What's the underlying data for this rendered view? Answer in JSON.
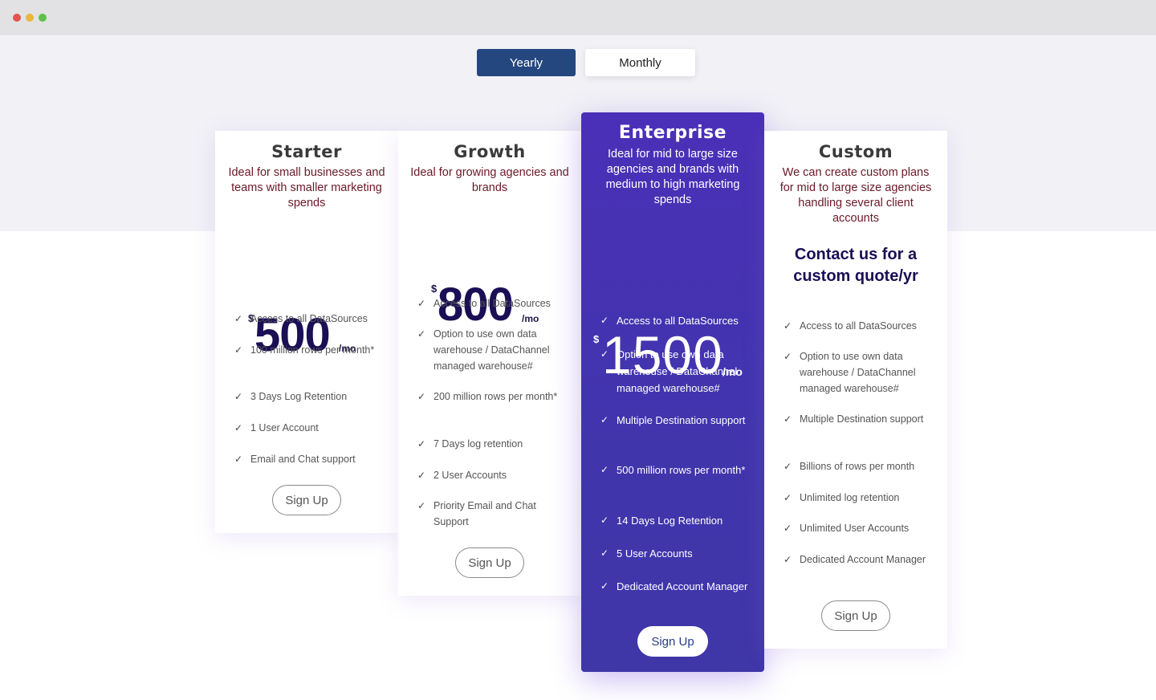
{
  "billing_toggle": {
    "yearly": "Yearly",
    "monthly": "Monthly"
  },
  "plans": [
    {
      "name": "Starter",
      "description": "Ideal for small businesses and teams with smaller marketing spends",
      "currency": "$",
      "price": "500",
      "period": "/mo",
      "features": [
        "Access to all DataSources",
        "100 million rows per month*",
        "3 Days Log Retention",
        "1 User Account",
        "Email and Chat support"
      ],
      "cta": "Sign Up"
    },
    {
      "name": "Growth",
      "description": "Ideal for growing agencies and brands",
      "currency": "$",
      "price": "800",
      "period": "/mo",
      "features": [
        "Access to all DataSources",
        "Option to use own data warehouse / DataChannel managed warehouse#",
        "200 million rows per month*",
        "7 Days log retention",
        "2 User Accounts",
        "Priority Email and Chat Support"
      ],
      "cta": "Sign Up"
    },
    {
      "name": "Enterprise",
      "description": "Ideal for mid to large size agencies and brands with medium to high marketing spends",
      "currency": "$",
      "price": "1500",
      "period": "/mo",
      "features": [
        "Access to all DataSources",
        "Option to use own data warehouse / DataChannel managed warehouse#",
        "Multiple Destination support",
        "500 million rows per month*",
        "14 Days Log Retention",
        "5 User Accounts",
        "Dedicated Account Manager"
      ],
      "cta": "Sign Up"
    },
    {
      "name": "Custom",
      "description": "We can create custom plans for mid to large size agencies handling several client accounts",
      "contact": "Contact us for a custom quote/yr",
      "features": [
        "Access to all DataSources",
        "Option to use own data warehouse / DataChannel managed warehouse#",
        "Multiple Destination support",
        "Billions of rows per month",
        "Unlimited log retention",
        "Unlimited User Accounts",
        "Dedicated Account Manager"
      ],
      "cta": "Sign Up"
    }
  ]
}
